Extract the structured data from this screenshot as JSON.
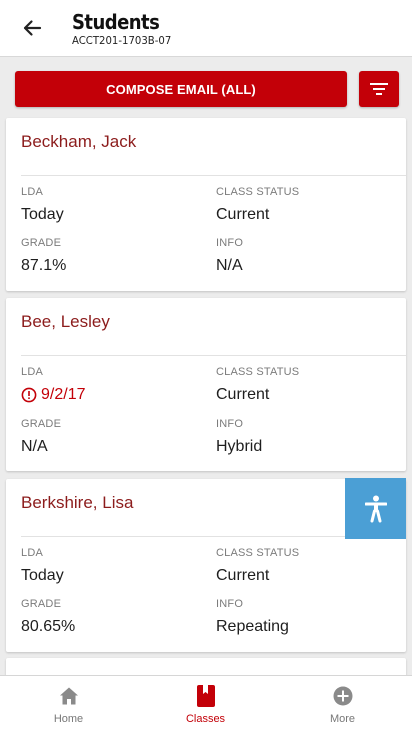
{
  "header": {
    "title": "Students",
    "subtitle": "ACCT201-1703B-07"
  },
  "actions": {
    "compose_label": "COMPOSE EMAIL (ALL)"
  },
  "students": [
    {
      "name": "Beckham, Jack",
      "lda_label": "LDA",
      "lda": "Today",
      "status_label": "CLASS STATUS",
      "status": "Current",
      "grade_label": "GRADE",
      "grade": "87.1%",
      "info_label": "INFO",
      "info": "N/A"
    },
    {
      "name": "Bee, Lesley",
      "lda_label": "LDA",
      "lda": "9/2/17",
      "status_label": "CLASS STATUS",
      "status": "Current",
      "grade_label": "GRADE",
      "grade": "N/A",
      "info_label": "INFO",
      "info": "Hybrid"
    },
    {
      "name": "Berkshire, Lisa",
      "lda_label": "LDA",
      "lda": "Today",
      "status_label": "CLASS STATUS",
      "status": "Current",
      "grade_label": "GRADE",
      "grade": "80.65%",
      "info_label": "INFO",
      "info": "Repeating"
    }
  ],
  "icons": {
    "back": "arrow-left-icon",
    "filter": "filter-icon",
    "alert": "alert-circle-icon",
    "accessibility": "accessibility-icon",
    "home": "home-icon",
    "classes": "book-icon",
    "more": "plus-circle-icon"
  },
  "colors": {
    "brand_red": "#c30008",
    "name_red": "#8c1c1c",
    "accessibility_blue": "#4b9fd5",
    "nav_inactive": "#777777"
  },
  "nav": {
    "items": [
      {
        "label": "Home",
        "active": false
      },
      {
        "label": "Classes",
        "active": true
      },
      {
        "label": "More",
        "active": false
      }
    ]
  }
}
